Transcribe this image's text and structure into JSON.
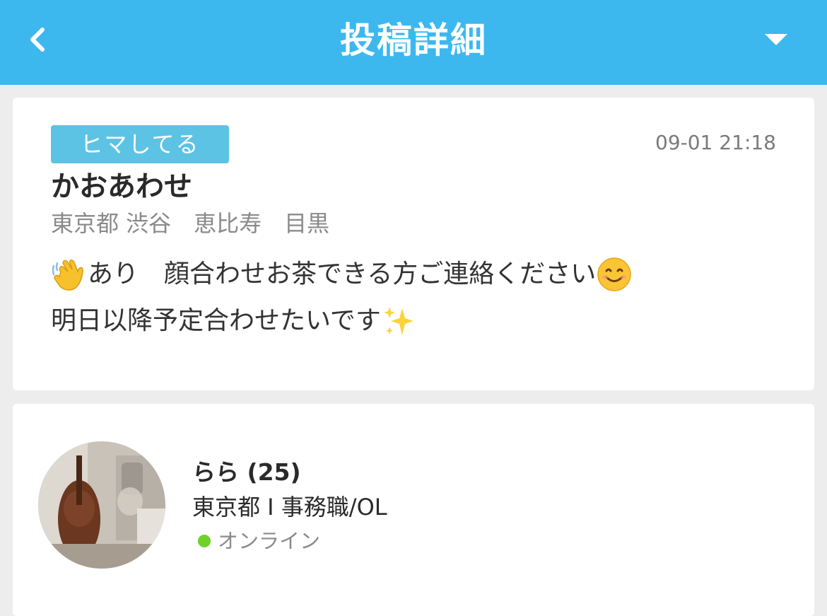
{
  "header": {
    "title": "投稿詳細",
    "back_icon": "chevron-left-icon",
    "menu_icon": "triangle-down-icon",
    "background_color": "#3cb8ef"
  },
  "post": {
    "badge": "ヒマしてる",
    "badge_color": "#5dc3e4",
    "timestamp": "09-01 21:18",
    "title": "かおあわせ",
    "location": "東京都 渋谷　恵比寿　目黒",
    "body_line1": "あり　顔合わせお茶できる方ご連絡ください",
    "body_line2": "明日以降予定合わせたいです",
    "emojis": [
      "waving-hand-icon",
      "smiling-face-icon",
      "sparkles-icon"
    ]
  },
  "user": {
    "name": "らら (25)",
    "info": "東京都 I 事務職/OL",
    "status": "オンライン",
    "status_color": "#6fd12a"
  }
}
